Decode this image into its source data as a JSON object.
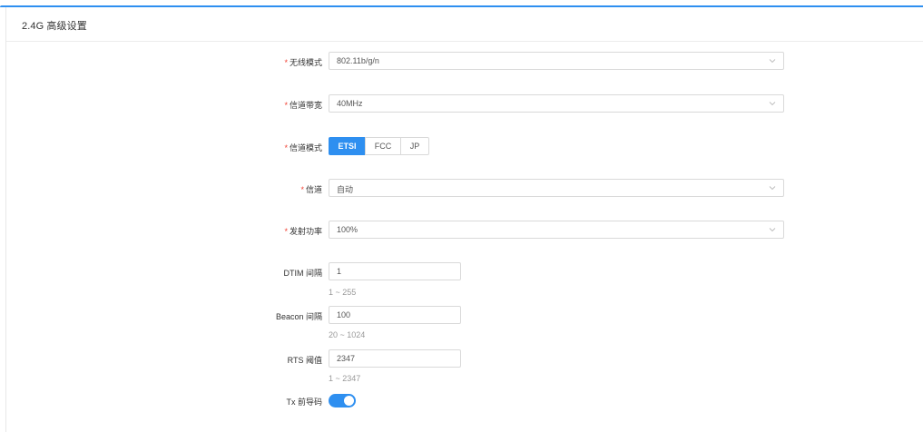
{
  "card": {
    "title": "2.4G 高级设置"
  },
  "form": {
    "wireless_mode": {
      "label": "无线模式",
      "value": "802.11b/g/n"
    },
    "bandwidth": {
      "label": "信道带宽",
      "value": "40MHz"
    },
    "channel_mode": {
      "label": "信道模式",
      "options": [
        "ETSI",
        "FCC",
        "JP"
      ],
      "selected": "ETSI"
    },
    "channel": {
      "label": "信道",
      "value": "自动"
    },
    "tx_power": {
      "label": "发射功率",
      "value": "100%"
    },
    "dtim": {
      "label": "DTIM 间隔",
      "value": "1",
      "hint": "1 ~ 255"
    },
    "beacon": {
      "label": "Beacon 间隔",
      "value": "100",
      "hint": "20 ~ 1024"
    },
    "rts": {
      "label": "RTS 阈值",
      "value": "2347",
      "hint": "1 ~ 2347"
    },
    "tx_preamble": {
      "label": "Tx 前导码",
      "enabled": true
    }
  },
  "required_mark": "*",
  "colors": {
    "accent": "#2e8ff0",
    "required": "#f04134"
  },
  "icons": {
    "select_arrow": "chevron-down-icon"
  }
}
